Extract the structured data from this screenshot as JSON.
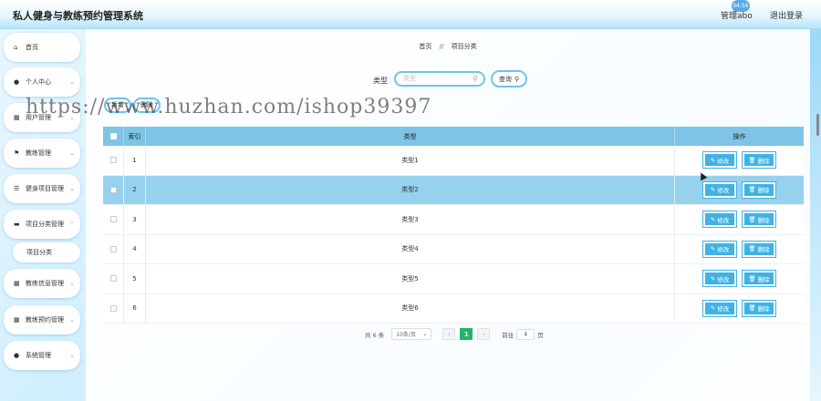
{
  "header": {
    "app_title": "私人健身与教练预约管理系统",
    "clock_badge": "04:56",
    "admin_label": "管理abo",
    "logout_label": "退出登录"
  },
  "sidebar": {
    "items": [
      {
        "label": "首页",
        "icon": "home-icon",
        "glyph": "⌂",
        "chevron": false
      },
      {
        "label": "个人中心",
        "icon": "person-icon",
        "glyph": "●",
        "chevron": true
      },
      {
        "label": "用户管理",
        "icon": "grid-icon",
        "glyph": "▦",
        "chevron": true
      },
      {
        "label": "教练管理",
        "icon": "flag-icon",
        "glyph": "⚑",
        "chevron": true
      },
      {
        "label": "健身项目管理",
        "icon": "list-icon",
        "glyph": "☰",
        "chevron": true
      },
      {
        "label": "项目分类管理",
        "icon": "folder-icon",
        "glyph": "▬",
        "chevron": true
      },
      {
        "label": "教练信息管理",
        "icon": "grid-icon",
        "glyph": "▦",
        "chevron": true
      },
      {
        "label": "教练预约管理",
        "icon": "grid-icon",
        "glyph": "▦",
        "chevron": true
      },
      {
        "label": "系统管理",
        "icon": "person-icon",
        "glyph": "●",
        "chevron": true
      }
    ],
    "sub_item": "项目分类"
  },
  "breadcrumb": {
    "home": "首页",
    "separator": "//",
    "current": "项目分类"
  },
  "search": {
    "label": "类型",
    "placeholder": "类型",
    "button_label": "查询"
  },
  "actions": {
    "add_label": "新增",
    "delete_label": "删除"
  },
  "table": {
    "headers": {
      "index": "索引",
      "type": "类型",
      "operation": "操作"
    },
    "rows": [
      {
        "index": "1",
        "type": "类型1"
      },
      {
        "index": "2",
        "type": "类型2"
      },
      {
        "index": "3",
        "type": "类型3"
      },
      {
        "index": "4",
        "type": "类型4"
      },
      {
        "index": "5",
        "type": "类型5"
      },
      {
        "index": "6",
        "type": "类型6"
      }
    ],
    "highlighted_row": 2,
    "edit_label": "修改",
    "delete_label": "删除"
  },
  "pagination": {
    "total": "共 6 条",
    "page_size": "10条/页",
    "current_page": "1",
    "goto_label": "前往",
    "goto_value": "1",
    "page_unit": "页"
  },
  "watermark": "https://www.huzhan.com/ishop39397",
  "colors": {
    "accent": "#3fb2e6",
    "header_row": "#7dc4e6",
    "active_page": "#24b36a"
  }
}
